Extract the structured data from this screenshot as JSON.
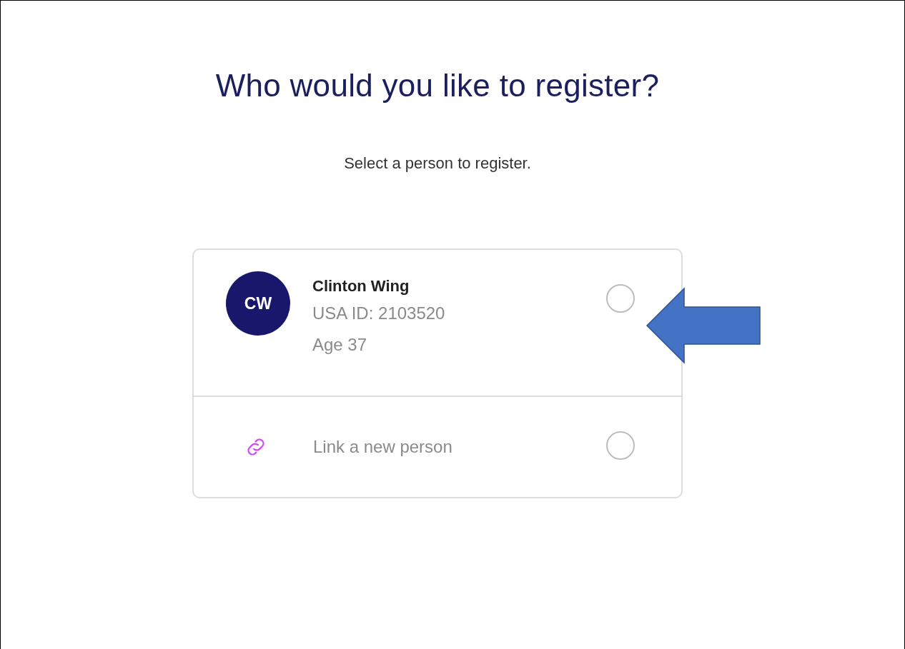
{
  "heading": "Who would you like to register?",
  "subheading": "Select a person to register.",
  "options": [
    {
      "kind": "person",
      "initials": "CW",
      "name": "Clinton Wing",
      "id_line": "USA ID: 2103520",
      "age": "Age 37",
      "selected": false
    },
    {
      "kind": "link",
      "label": "Link a new person",
      "selected": false
    }
  ]
}
